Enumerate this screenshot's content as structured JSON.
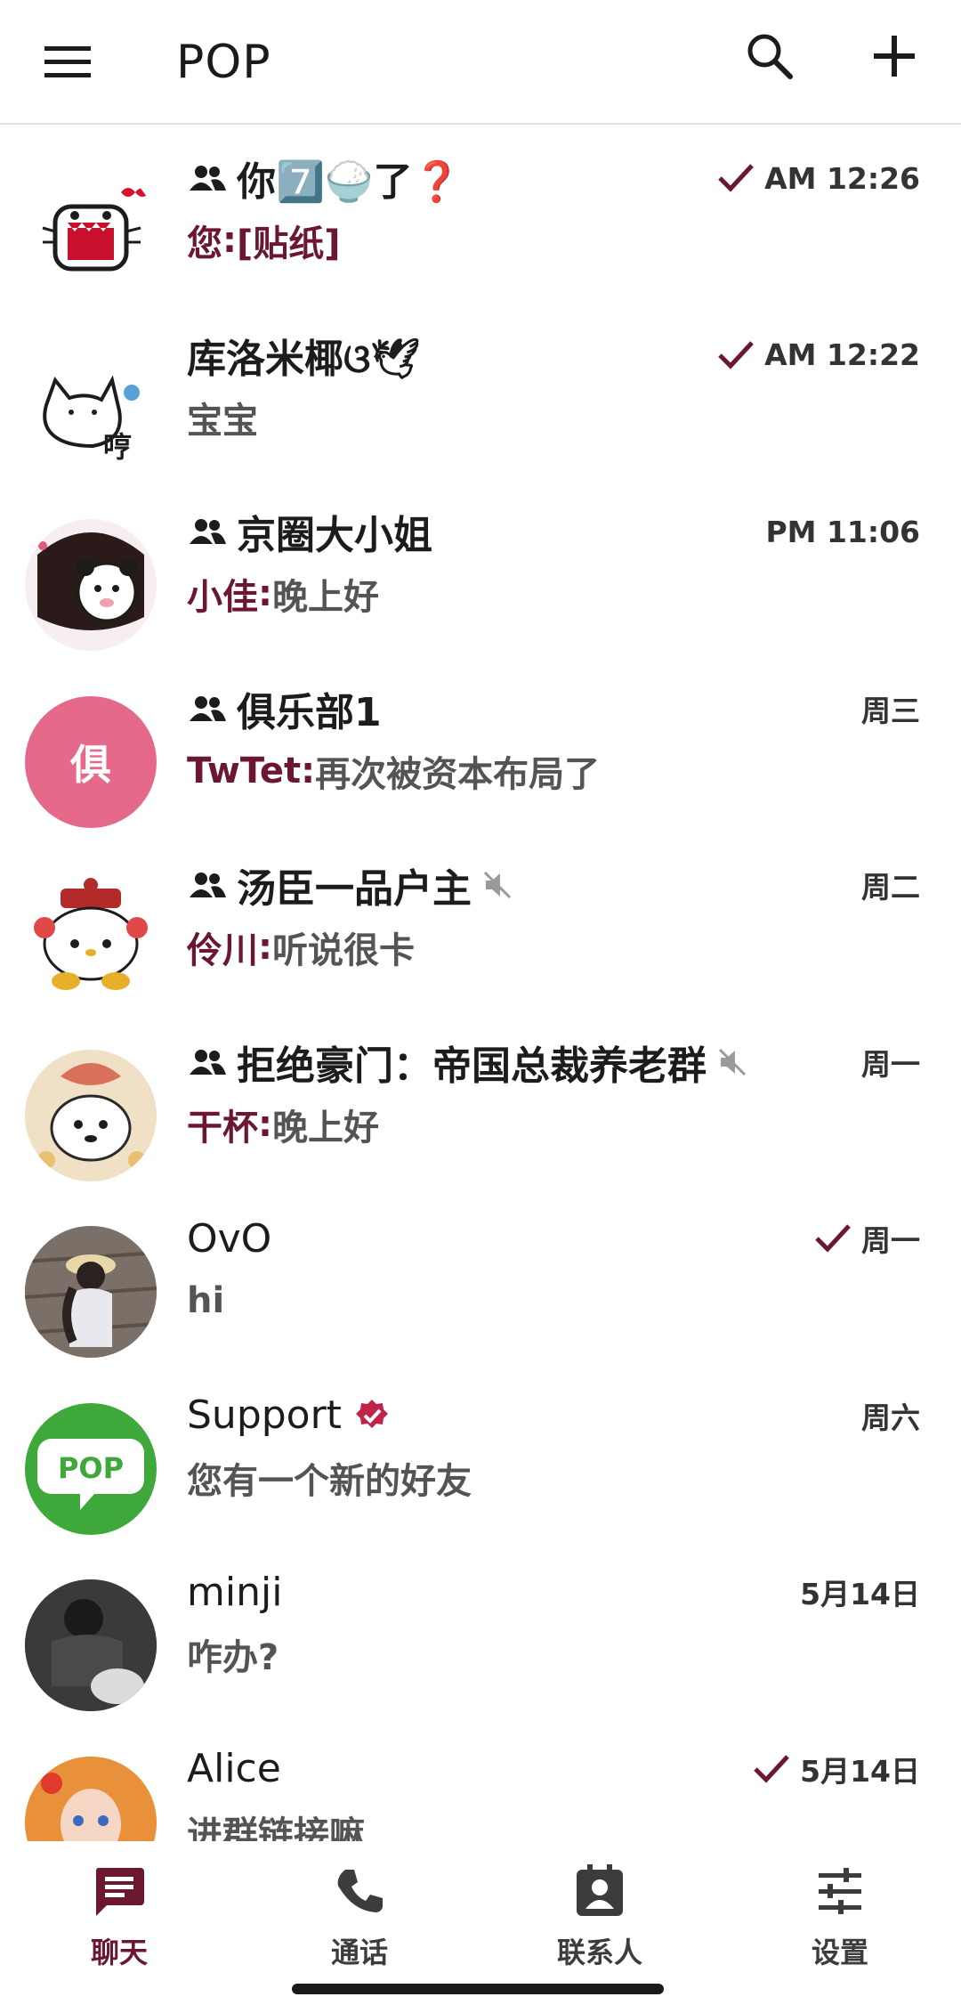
{
  "header": {
    "title": "POP",
    "menu_icon": "hamburger-menu-icon",
    "search_icon": "search-icon",
    "add_icon": "plus-icon"
  },
  "colors": {
    "accent": "#6b1730",
    "text": "#1c1c1c",
    "secondary_text": "#545454",
    "divider": "#e2e2e2"
  },
  "chats": [
    {
      "name": "你7️⃣🍚了❓",
      "is_group": true,
      "sender": "您",
      "message": "[贴纸]",
      "time": "AM 12:26",
      "sent_check": true,
      "muted": false,
      "verified": false
    },
    {
      "name": "库洛米椰ଓ🕊",
      "is_group": false,
      "sender": "",
      "message": "宝宝",
      "time": "AM 12:22",
      "sent_check": true,
      "muted": false,
      "verified": false,
      "avatar_text": "哼"
    },
    {
      "name": "京圈大小姐",
      "is_group": true,
      "sender": "小佳",
      "message": "晚上好",
      "time": "PM 11:06",
      "sent_check": false,
      "muted": false,
      "verified": false
    },
    {
      "name": "俱乐部1",
      "is_group": true,
      "sender": "TwTet",
      "message": "再次被资本布局了",
      "time": "周三",
      "sent_check": false,
      "muted": false,
      "verified": false,
      "avatar_text": "俱"
    },
    {
      "name": "汤臣一品户主",
      "is_group": true,
      "sender": "伶川",
      "message": "听说很卡",
      "time": "周二",
      "sent_check": false,
      "muted": true,
      "verified": false
    },
    {
      "name": "拒绝豪门：帝国总裁养老群",
      "is_group": true,
      "sender": "干杯",
      "message": "晚上好",
      "time": "周一",
      "sent_check": false,
      "muted": true,
      "verified": false
    },
    {
      "name": "OvO",
      "is_group": false,
      "sender": "",
      "message": "hi",
      "time": "周一",
      "sent_check": true,
      "muted": false,
      "verified": false
    },
    {
      "name": "Support",
      "is_group": false,
      "sender": "",
      "message": "您有一个新的好友",
      "time": "周六",
      "sent_check": false,
      "muted": false,
      "verified": true,
      "avatar_text": "POP"
    },
    {
      "name": "minji",
      "is_group": false,
      "sender": "",
      "message": "咋办?",
      "time": "5月14日",
      "sent_check": false,
      "muted": false,
      "verified": false
    },
    {
      "name": "Alice",
      "is_group": false,
      "sender": "",
      "message": "进群链接嘛",
      "time": "5月14日",
      "sent_check": true,
      "muted": false,
      "verified": false
    }
  ],
  "nav": {
    "chats": {
      "label": "聊天",
      "icon": "chat-bubble-icon"
    },
    "calls": {
      "label": "通话",
      "icon": "phone-icon"
    },
    "contacts": {
      "label": "联系人",
      "icon": "contact-card-icon"
    },
    "settings": {
      "label": "设置",
      "icon": "sliders-icon"
    }
  }
}
